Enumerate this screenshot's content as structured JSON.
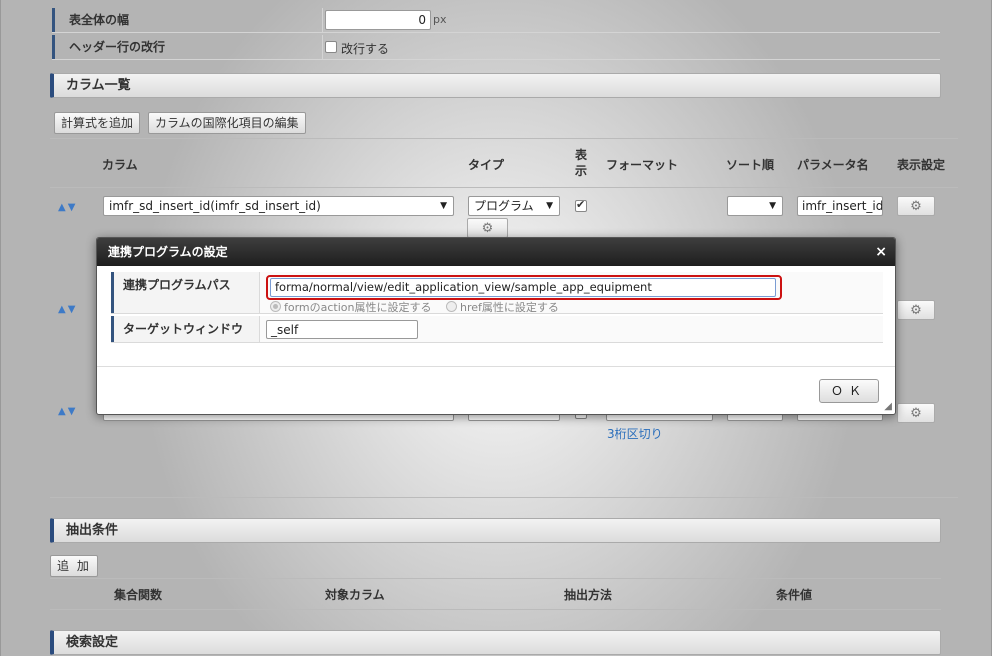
{
  "table_settings": {
    "width_label": "表全体の幅",
    "width_value": "0",
    "width_unit": "px",
    "header_wrap_label": "ヘッダー行の改行",
    "header_wrap_option": "改行する"
  },
  "columns_section": {
    "title": "カラム一覧",
    "add_formula_button": "計算式を追加",
    "i18n_edit_button": "カラムの国際化項目の編集",
    "headers": {
      "column": "カラム",
      "type": "タイプ",
      "display": "表示",
      "format": "フォーマット",
      "sort_order": "ソート順",
      "parameter_name": "パラメータ名",
      "display_settings": "表示設定"
    },
    "row1": {
      "column_value": "imfr_sd_insert_id(imfr_sd_insert_id)",
      "type_value": "プログラム",
      "display_checked": true,
      "sort_value": "",
      "parameter_value": "imfr_insert_id"
    },
    "row3": {
      "format_link": "3桁区切り"
    }
  },
  "icons": {
    "sort_arrows": "up-down-arrows-icon",
    "settings": "gear-icon"
  },
  "extract_section": {
    "title": "抽出条件",
    "add_button": "追 加",
    "headers": {
      "aggregate": "集合関数",
      "target_column": "対象カラム",
      "method": "抽出方法",
      "condition_value": "条件値"
    }
  },
  "search_section": {
    "title": "検索設定"
  },
  "dialog": {
    "title": "連携プログラムの設定",
    "close": "×",
    "program_path_label": "連携プログラムパス",
    "program_path_value": "forma/normal/view/edit_application_view/sample_app_equipment",
    "radio_action_label": "formのaction属性に設定する",
    "radio_href_label": "href属性に設定する",
    "target_window_label": "ターゲットウィンドウ",
    "target_window_value": "_self",
    "ok_button": "ＯＫ"
  },
  "colors": {
    "dialog_titlebar": "#2a2a2a",
    "section_accent": "#2b4c7e",
    "highlight_border": "#cc0000",
    "link": "#2a6ebb"
  }
}
